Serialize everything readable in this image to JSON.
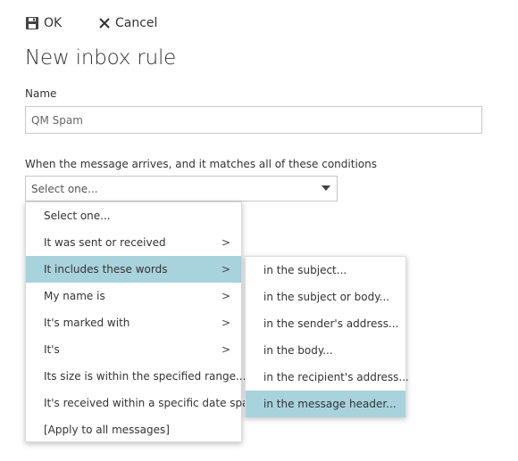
{
  "toolbar": {
    "ok_label": "OK",
    "cancel_label": "Cancel"
  },
  "page": {
    "title": "New inbox rule"
  },
  "name_field": {
    "label": "Name",
    "value": "QM Spam"
  },
  "conditions": {
    "label": "When the message arrives, and it matches all of these conditions",
    "select_value": "Select one..."
  },
  "main_menu": {
    "items": [
      {
        "label": "Select one...",
        "has_submenu": false
      },
      {
        "label": "It was sent or received",
        "has_submenu": true
      },
      {
        "label": "It includes these words",
        "has_submenu": true,
        "selected": true
      },
      {
        "label": "My name is",
        "has_submenu": true
      },
      {
        "label": "It's marked with",
        "has_submenu": true
      },
      {
        "label": "It's",
        "has_submenu": true
      },
      {
        "label": "Its size is within the specified range...",
        "has_submenu": false
      },
      {
        "label": "It's received within a specific date span...",
        "has_submenu": false
      },
      {
        "label": "[Apply to all messages]",
        "has_submenu": false
      }
    ]
  },
  "sub_menu": {
    "items": [
      {
        "label": "in the subject..."
      },
      {
        "label": "in the subject or body..."
      },
      {
        "label": "in the sender's address..."
      },
      {
        "label": "in the body..."
      },
      {
        "label": "in the recipient's address..."
      },
      {
        "label": "in the message header...",
        "selected": true
      }
    ]
  },
  "colors": {
    "selected_item_bg": "#a8d3dc"
  },
  "icons": {
    "ok": "floppy-disk-icon",
    "cancel": "close-icon",
    "dropdown": "caret-down-icon",
    "submenu": "chevron-right-icon"
  }
}
